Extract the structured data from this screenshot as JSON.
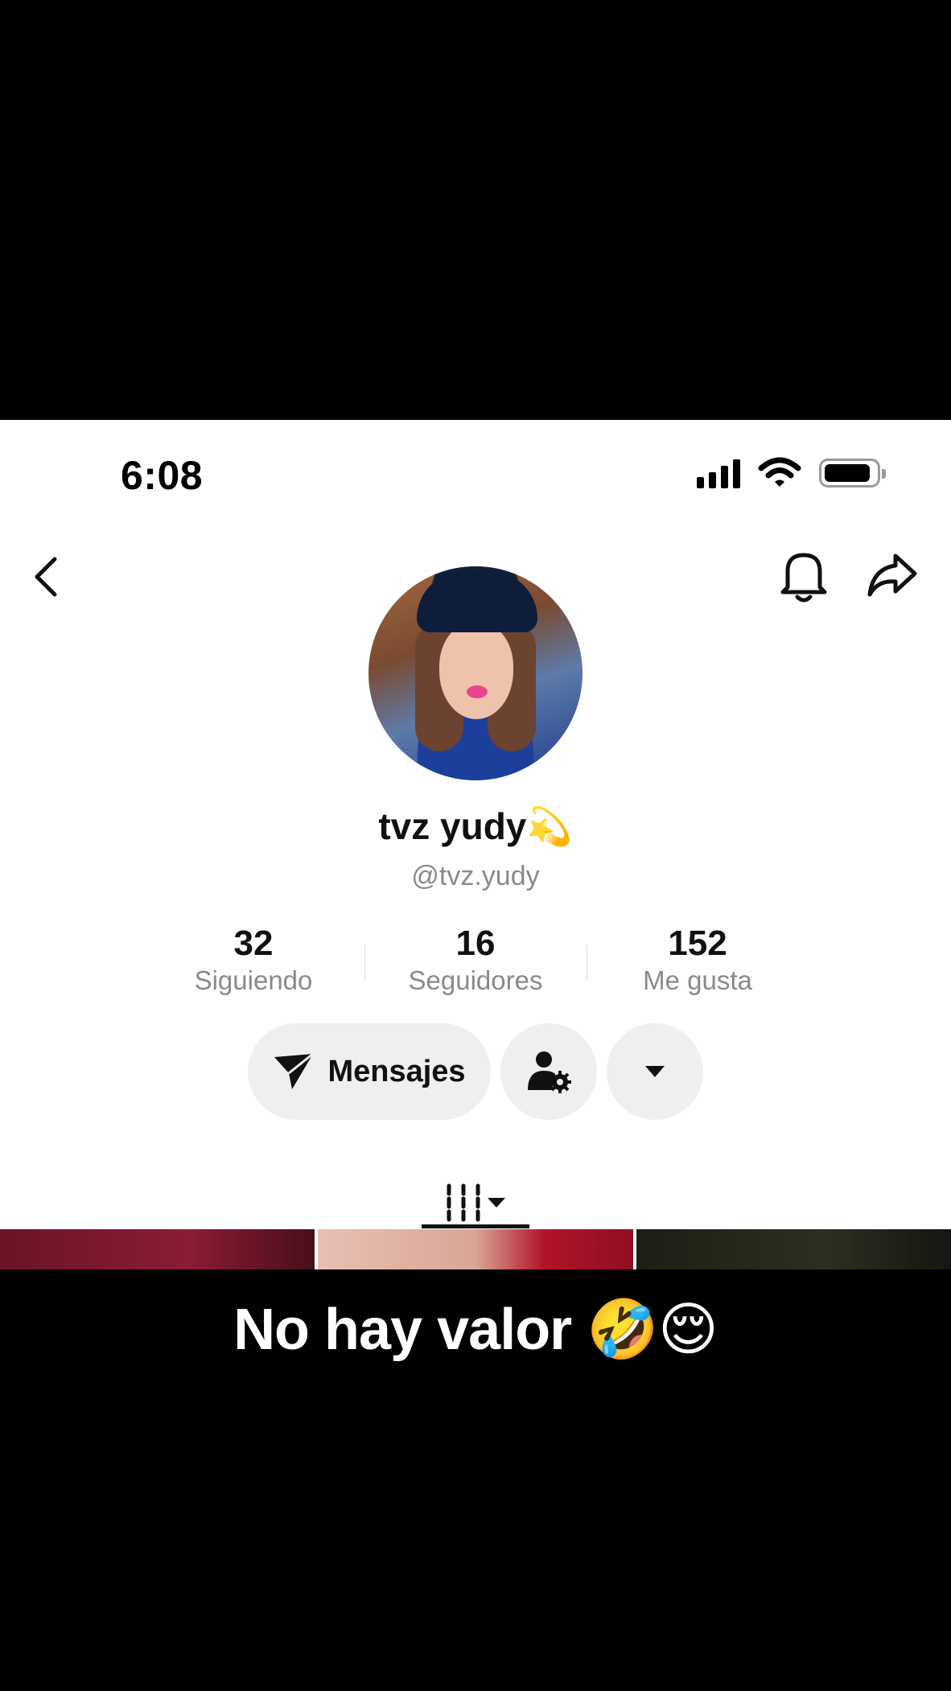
{
  "status_bar": {
    "time": "6:08"
  },
  "profile": {
    "display_name": "tvz yudy💫",
    "username": "@tvz.yudy"
  },
  "stats": [
    {
      "value": "32",
      "label": "Siguiendo"
    },
    {
      "value": "16",
      "label": "Seguidores"
    },
    {
      "value": "152",
      "label": "Me gusta"
    }
  ],
  "actions": {
    "messages_label": "Mensajes"
  },
  "caption": "No hay valor 🤣😌",
  "icons": {
    "back": "chevron-left-icon",
    "bell": "bell-icon",
    "share": "share-arrow-icon",
    "messages": "paper-plane-icon",
    "friend_settings": "person-gear-icon",
    "dropdown": "caret-down-icon",
    "grid": "grid-icon"
  }
}
